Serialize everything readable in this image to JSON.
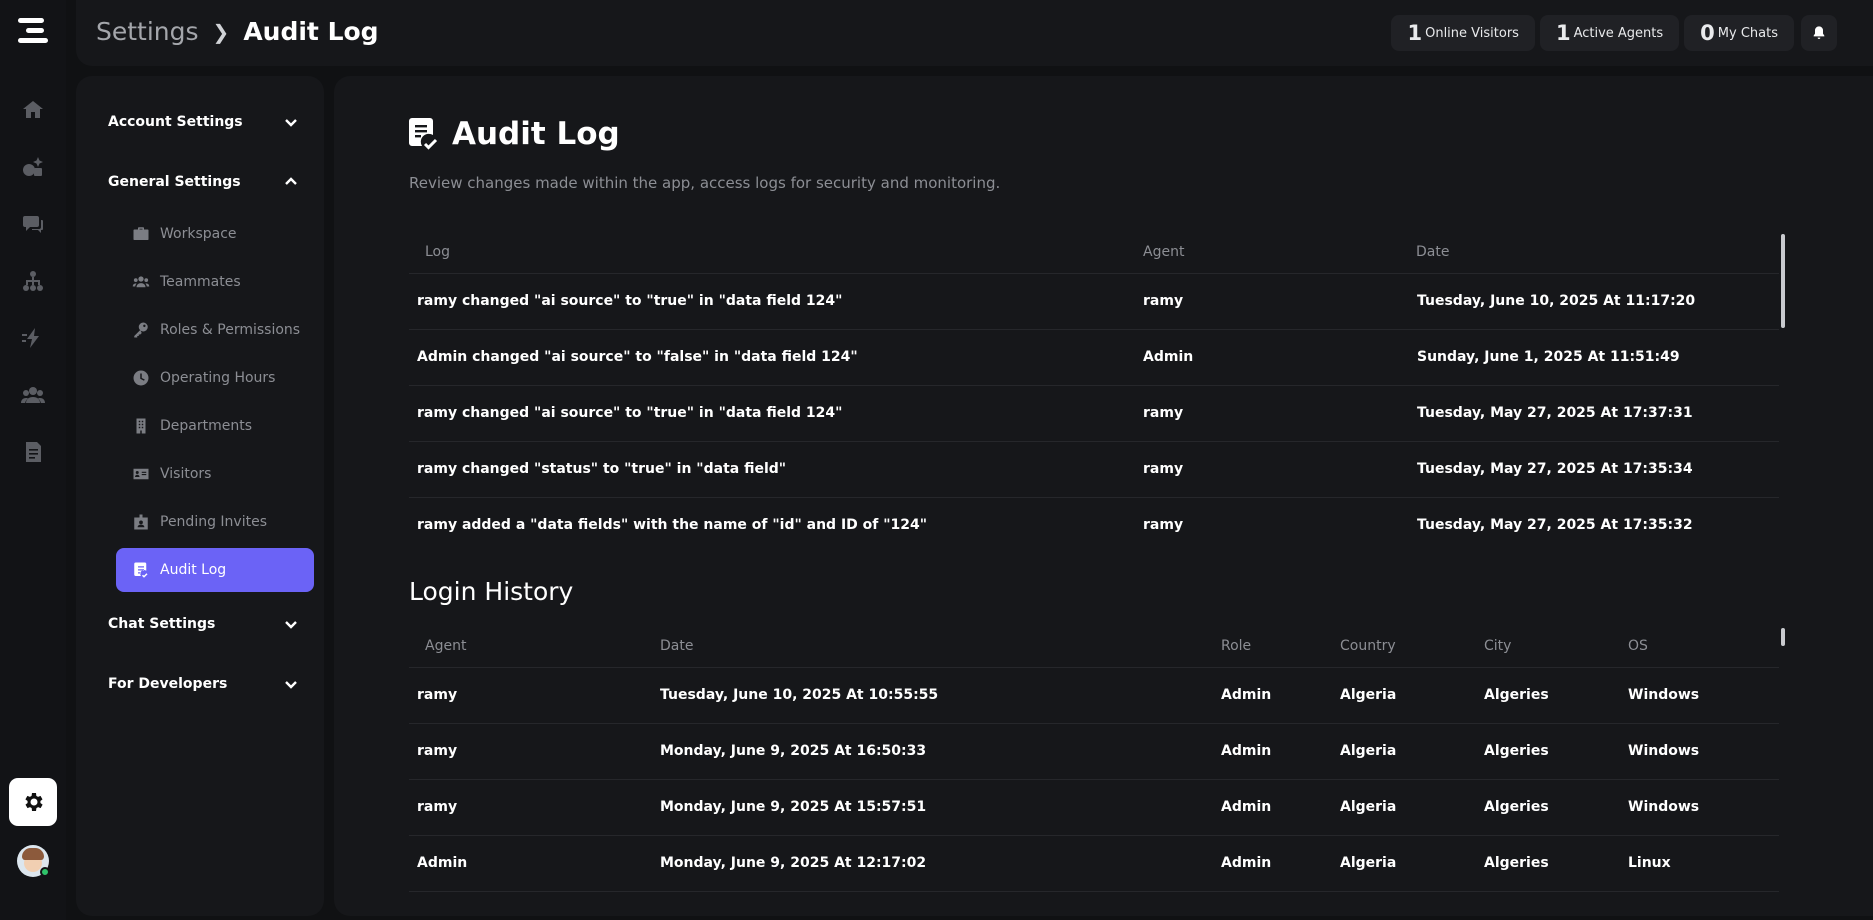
{
  "breadcrumb": {
    "root": "Settings",
    "current": "Audit Log"
  },
  "stats": [
    {
      "num": "1",
      "label": "Online Visitors"
    },
    {
      "num": "1",
      "label": "Active Agents"
    },
    {
      "num": "0",
      "label": "My Chats"
    }
  ],
  "sidebar": {
    "account_settings": "Account Settings",
    "general_settings": "General Settings",
    "items": [
      {
        "label": "Workspace",
        "icon": "briefcase-icon"
      },
      {
        "label": "Teammates",
        "icon": "users-icon"
      },
      {
        "label": "Roles & Permissions",
        "icon": "key-icon"
      },
      {
        "label": "Operating Hours",
        "icon": "clock-icon"
      },
      {
        "label": "Departments",
        "icon": "building-icon"
      },
      {
        "label": "Visitors",
        "icon": "id-card-icon"
      },
      {
        "label": "Pending Invites",
        "icon": "badge-icon"
      },
      {
        "label": "Audit Log",
        "icon": "audit-icon"
      }
    ],
    "chat_settings": "Chat Settings",
    "for_developers": "For Developers"
  },
  "page": {
    "title": "Audit Log",
    "subtitle": "Review changes made within the app, access logs for security and monitoring."
  },
  "audit": {
    "columns": [
      "Log",
      "Agent",
      "Date"
    ],
    "rows": [
      {
        "log": "ramy changed \"ai source\" to \"true\" in \"data field 124\"",
        "agent": "ramy",
        "date": "Tuesday, June 10, 2025 At 11:17:20"
      },
      {
        "log": "Admin changed \"ai source\" to \"false\" in \"data field 124\"",
        "agent": "Admin",
        "date": "Sunday, June 1, 2025 At 11:51:49"
      },
      {
        "log": "ramy changed \"ai source\" to \"true\" in \"data field 124\"",
        "agent": "ramy",
        "date": "Tuesday, May 27, 2025 At 17:37:31"
      },
      {
        "log": "ramy changed \"status\" to \"true\" in \"data field\"",
        "agent": "ramy",
        "date": "Tuesday, May 27, 2025 At 17:35:34"
      },
      {
        "log": "ramy added a \"data fields\" with the name of \"id\" and ID of \"124\"",
        "agent": "ramy",
        "date": "Tuesday, May 27, 2025 At 17:35:32"
      }
    ]
  },
  "login": {
    "title": "Login History",
    "columns": [
      "Agent",
      "Date",
      "Role",
      "Country",
      "City",
      "OS"
    ],
    "rows": [
      {
        "agent": "ramy",
        "date": "Tuesday, June 10, 2025 At 10:55:55",
        "role": "Admin",
        "country": "Algeria",
        "city": "Algeries",
        "os": "Windows"
      },
      {
        "agent": "ramy",
        "date": "Monday, June 9, 2025 At 16:50:33",
        "role": "Admin",
        "country": "Algeria",
        "city": "Algeries",
        "os": "Windows"
      },
      {
        "agent": "ramy",
        "date": "Monday, June 9, 2025 At 15:57:51",
        "role": "Admin",
        "country": "Algeria",
        "city": "Algeries",
        "os": "Windows"
      },
      {
        "agent": "Admin",
        "date": "Monday, June 9, 2025 At 12:17:02",
        "role": "Admin",
        "country": "Algeria",
        "city": "Algeries",
        "os": "Linux"
      }
    ]
  },
  "colors": {
    "accent": "#6b63f6",
    "background": "#101113",
    "panel": "#16171a"
  }
}
